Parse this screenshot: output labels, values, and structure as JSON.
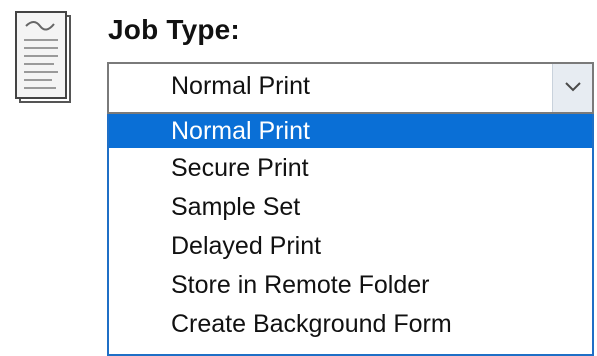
{
  "job_type": {
    "label": "Job Type:",
    "current_value": "Normal Print",
    "options": [
      "Normal Print",
      "Secure Print",
      "Sample Set",
      "Delayed Print",
      "Store in Remote Folder",
      "Create Background Form"
    ],
    "highlighted_option": "Normal Print",
    "icon": "document-icon",
    "dropdown_icon": "chevron-down-icon"
  },
  "colors": {
    "highlight": "#0a6fd6",
    "list_border": "#1f6fc6",
    "combo_border": "#7a7a7a",
    "arrow_background": "#e7ecf2"
  }
}
